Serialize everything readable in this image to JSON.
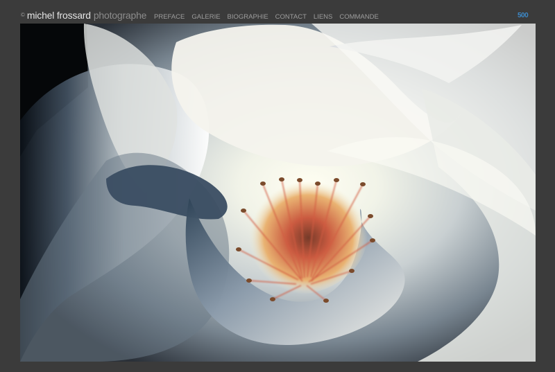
{
  "site": {
    "copyright_symbol": "©",
    "owner": "michel frossard",
    "role": "photographe"
  },
  "nav": {
    "items": [
      {
        "label": "PREFACE"
      },
      {
        "label": "GALERIE"
      },
      {
        "label": "BIOGRAPHIE"
      },
      {
        "label": "CONTACT"
      },
      {
        "label": "LIENS"
      },
      {
        "label": "COMMANDE"
      }
    ]
  },
  "badge": {
    "label": "500",
    "icon": "500px-icon",
    "color": "#3d89c8"
  },
  "photo": {
    "subject": "white-rose-icon"
  },
  "colors": {
    "background": "#3b3b3b",
    "name_text": "#e4e4e4",
    "role_text": "#8c8c8c",
    "nav_text": "#9d9d9d"
  }
}
